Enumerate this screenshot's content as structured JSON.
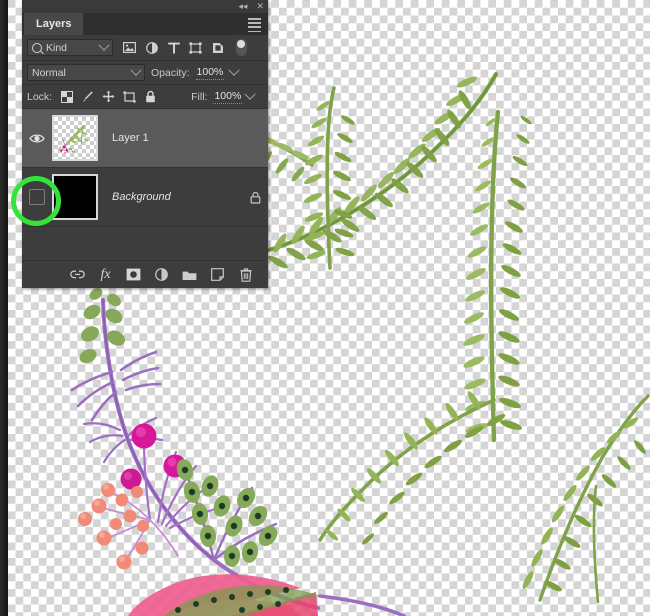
{
  "app": {
    "panel_title": "Layers"
  },
  "titlebar": {
    "collapse_icon": "collapse-double-arrow-icon",
    "collapse_glyph": "◂◂",
    "close_icon": "close-icon",
    "close_glyph": "✕"
  },
  "panel": {
    "menu_icon": "panel-menu-icon"
  },
  "filter_row": {
    "kind_label": "Kind",
    "search_icon": "search-icon",
    "dropdown_icon": "chevron-down-icon",
    "icons": [
      {
        "name": "filter-pixel-layers-icon",
        "title": "Pixel layers"
      },
      {
        "name": "filter-adjustment-layers-icon",
        "title": "Adjustment layers"
      },
      {
        "name": "filter-type-layers-icon",
        "title": "Type layers",
        "glyph": "T"
      },
      {
        "name": "filter-shape-layers-icon",
        "title": "Shape layers"
      },
      {
        "name": "filter-smart-object-layers-icon",
        "title": "Smart objects"
      }
    ],
    "toggle_icon": "filter-enable-toggle"
  },
  "blend_row": {
    "blend_mode": "Normal",
    "opacity_label": "Opacity:",
    "opacity_value": "100%",
    "dropdown_icon": "chevron-down-icon"
  },
  "lock_row": {
    "lock_label": "Lock:",
    "fill_label": "Fill:",
    "fill_value": "100%",
    "icons": [
      {
        "name": "lock-transparent-pixels-icon"
      },
      {
        "name": "lock-image-pixels-icon"
      },
      {
        "name": "lock-position-icon"
      },
      {
        "name": "lock-artboard-nesting-icon"
      },
      {
        "name": "lock-all-icon"
      }
    ]
  },
  "layers": [
    {
      "name": "Layer 1",
      "visible": true,
      "selected": true,
      "locked": false,
      "italic": false,
      "thumbnail": "transparent-artwork-thumbnail",
      "visibility_icon": "eye-icon"
    },
    {
      "name": "Background",
      "visible": false,
      "selected": false,
      "locked": true,
      "italic": true,
      "thumbnail": "black-thumbnail",
      "visibility_icon": "eye-off-empty-slot",
      "lock_icon": "lock-icon"
    }
  ],
  "bottom_toolbar": [
    {
      "name": "link-layers-button",
      "icon": "link-icon"
    },
    {
      "name": "layer-style-button",
      "icon": "fx-icon",
      "label": "fx"
    },
    {
      "name": "add-layer-mask-button",
      "icon": "layer-mask-icon"
    },
    {
      "name": "new-adjustment-layer-button",
      "icon": "adjustment-layer-icon"
    },
    {
      "name": "new-group-button",
      "icon": "folder-icon"
    },
    {
      "name": "new-layer-button",
      "icon": "new-layer-icon"
    },
    {
      "name": "delete-layer-button",
      "icon": "trash-icon"
    }
  ],
  "annotation": {
    "highlight_color": "#35e43a",
    "target": "background-layer-visibility-toggle"
  },
  "canvas": {
    "document_type": "transparent-watercolor-botanical-artwork",
    "colors": {
      "fern_light": "#a8c06a",
      "fern_mid": "#8aad55",
      "fern_dark": "#6c8f3e",
      "purple_stem": "#9b6fbf",
      "magenta": "#d91a8c",
      "coral": "#f08a78",
      "pink": "#ef5d9b",
      "olive": "#7d9b4e",
      "dark_dot": "#1e3a22"
    }
  }
}
